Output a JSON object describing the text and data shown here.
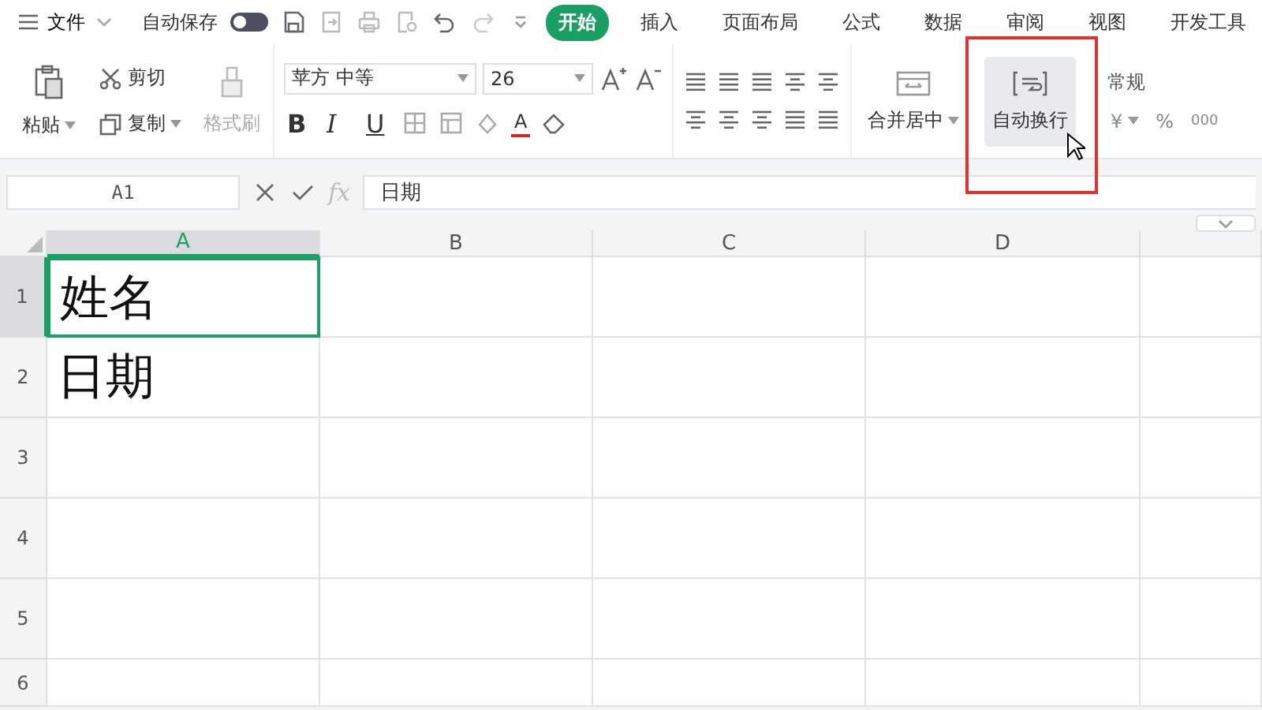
{
  "menu": {
    "label": "文件"
  },
  "autosave": {
    "label": "自动保存",
    "on": false
  },
  "tabs": [
    {
      "label": "开始",
      "selected": true
    },
    {
      "label": "插入",
      "selected": false
    },
    {
      "label": "页面布局",
      "selected": false
    },
    {
      "label": "公式",
      "selected": false
    },
    {
      "label": "数据",
      "selected": false
    },
    {
      "label": "审阅",
      "selected": false
    },
    {
      "label": "视图",
      "selected": false
    },
    {
      "label": "开发工具",
      "selected": false
    }
  ],
  "clipboard": {
    "paste": "粘贴",
    "cut": "剪切",
    "copy": "复制",
    "format_painter": "格式刷"
  },
  "font": {
    "name": "苹方 中等",
    "size": "26",
    "bold": "B",
    "italic": "I",
    "underline": "U",
    "font_color": "A"
  },
  "alignment": {
    "merge": "合并居中",
    "wrap": "自动换行"
  },
  "number": {
    "format": "常规",
    "currency": "¥",
    "percent": "%",
    "thousands": "000"
  },
  "formula_bar": {
    "cell_ref": "A1",
    "fx": "fx",
    "value": "日期"
  },
  "sheet": {
    "columns": [
      {
        "label": "A",
        "selected": true
      },
      {
        "label": "B",
        "selected": false
      },
      {
        "label": "C",
        "selected": false
      },
      {
        "label": "D",
        "selected": false
      }
    ],
    "rows": [
      {
        "label": "1",
        "selected": true,
        "cells": [
          "姓名"
        ]
      },
      {
        "label": "2",
        "selected": false,
        "cells": [
          "日期"
        ]
      },
      {
        "label": "3",
        "selected": false,
        "cells": []
      },
      {
        "label": "4",
        "selected": false,
        "cells": []
      },
      {
        "label": "5",
        "selected": false,
        "cells": []
      },
      {
        "label": "6",
        "selected": false,
        "cells": []
      }
    ]
  }
}
